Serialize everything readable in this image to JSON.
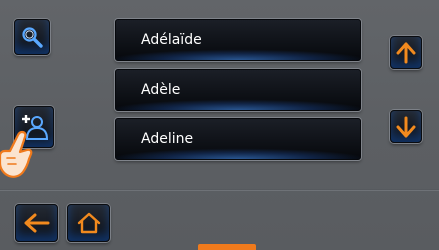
{
  "list": {
    "items": [
      {
        "label": "Adélaïde"
      },
      {
        "label": "Adèle"
      },
      {
        "label": "Adeline"
      }
    ]
  },
  "icons": {
    "search": "magnifier-icon",
    "add_contact": "add-person-icon",
    "scroll_up": "arrow-up-icon",
    "scroll_down": "arrow-down-icon",
    "back": "arrow-left-icon",
    "home": "home-icon",
    "pointer": "pointing-hand-icon"
  },
  "colors": {
    "accent_blue": "#3a8cff",
    "accent_orange": "#f28a1e",
    "background": "#5d6064"
  }
}
